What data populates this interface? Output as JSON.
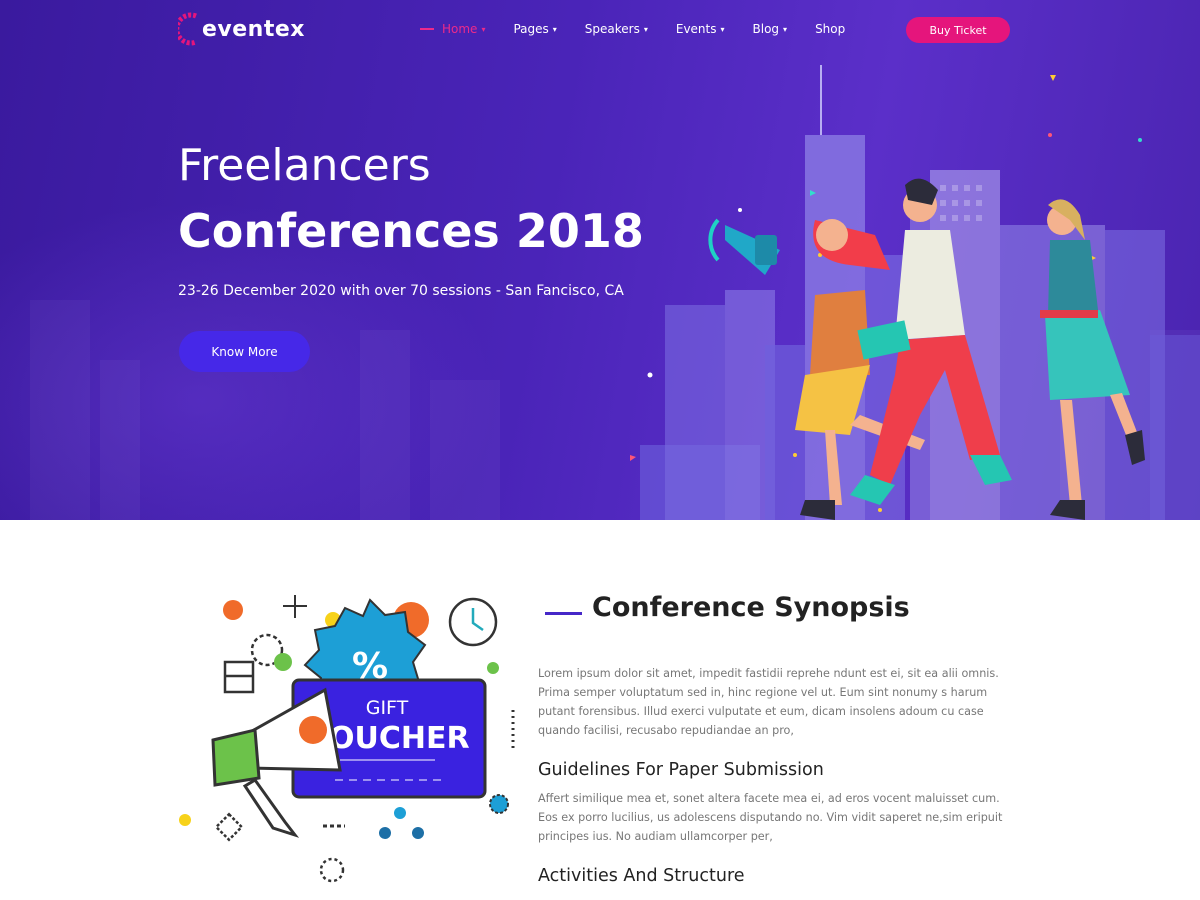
{
  "brand": {
    "name": "eventex"
  },
  "nav": {
    "items": [
      {
        "label": "Home",
        "active": true
      },
      {
        "label": "Pages"
      },
      {
        "label": "Speakers"
      },
      {
        "label": "Events"
      },
      {
        "label": "Blog"
      },
      {
        "label": "Shop"
      }
    ],
    "cta_label": "Buy Ticket"
  },
  "hero": {
    "subtitle": "Freelancers",
    "title": "Conferences 2018",
    "description": "23-26 December 2020 with over 70 sessions - San Fancisco, CA",
    "button_label": "Know More"
  },
  "voucher": {
    "line1": "GIFT",
    "line2": "VOUCHER",
    "symbol": "%"
  },
  "synopsis": {
    "title": "Conference Synopsis",
    "intro": "Lorem ipsum dolor sit amet, impedit fastidii reprehe ndunt est ei, sit ea alii omnis. Prima semper voluptatum sed in, hinc regione vel ut. Eum sint nonumy s harum putant forensibus. Illud exerci vulputate et eum, dicam insolens adoum cu case quando facilisi, recusabo repudiandae an pro,",
    "guidelines_title": "Guidelines For Paper Submission",
    "guidelines_text": "Affert similique mea et, sonet altera facete mea ei, ad eros vocent maluisset cum. Eos ex porro lucilius, us adolescens disputando no. Vim vidit saperet ne,sim eripuit principes ius. No audiam ullamcorper per,",
    "activities_title": "Activities And Structure"
  },
  "colors": {
    "hero_bg": "#4a24b8",
    "accent_pink": "#e5157c",
    "accent_blue": "#4628e8",
    "voucher_blue": "#3a22e0"
  }
}
